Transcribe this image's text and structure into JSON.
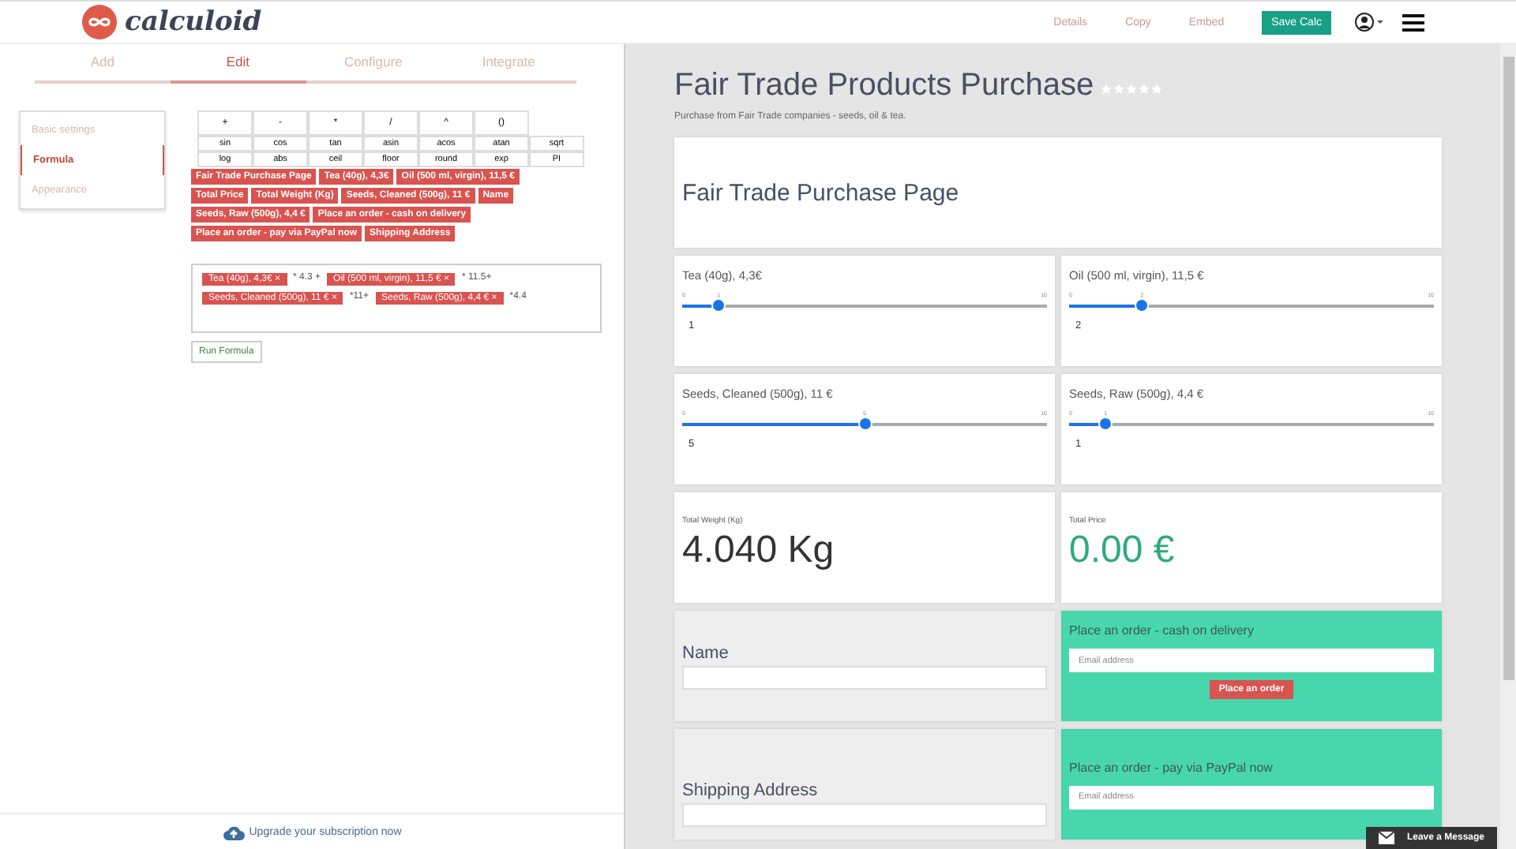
{
  "header": {
    "logo": "calculoid",
    "links": [
      {
        "label": "Details"
      },
      {
        "label": "Copy"
      },
      {
        "label": "Embed"
      }
    ],
    "save_button": "Save Calc"
  },
  "tabs": [
    {
      "label": "Add",
      "selected": false
    },
    {
      "label": "Edit",
      "selected": true
    },
    {
      "label": "Configure",
      "selected": false
    },
    {
      "label": "Integrate",
      "selected": false
    }
  ],
  "sidebar": {
    "items": [
      {
        "label": "Basic settings",
        "selected": false
      },
      {
        "label": "Formula",
        "selected": true
      },
      {
        "label": "Appearance",
        "selected": false
      }
    ]
  },
  "function_keys": [
    [
      "+",
      "-",
      "*",
      "/",
      "^",
      "()"
    ],
    [
      "sin",
      "cos",
      "tan",
      "asin",
      "acos",
      "atan",
      "sqrt"
    ],
    [
      "log",
      "abs",
      "ceil",
      "floor",
      "round",
      "exp",
      "PI"
    ]
  ],
  "field_tags": [
    "Fair Trade Purchase Page",
    "Tea (40g), 4,3€",
    "Oil (500 ml, virgin), 11,5 €",
    "Total Price",
    "Total Weight (Kg)",
    "Seeds, Cleaned (500g), 11 €",
    "Name",
    "Seeds, Raw (500g), 4,4 €",
    "Place an order - cash on delivery",
    "Place an order - pay via PayPal now",
    "Shipping Address"
  ],
  "formula": [
    {
      "kind": "tag",
      "text": "Tea (40g), 4,3€ ×"
    },
    {
      "kind": "text",
      "text": "* 4.3 +"
    },
    {
      "kind": "tag",
      "text": "Oil (500 ml, virgin), 11,5 € ×"
    },
    {
      "kind": "text",
      "text": "* 11.5+"
    },
    {
      "kind": "tag",
      "text": "Seeds, Cleaned (500g), 11 € ×"
    },
    {
      "kind": "text",
      "text": "*11+"
    },
    {
      "kind": "tag",
      "text": "Seeds, Raw (500g), 4,4 € ×"
    },
    {
      "kind": "text",
      "text": "*4.4"
    }
  ],
  "run_button": "Run Formula",
  "upgrade_link": "Upgrade your subscription now",
  "preview": {
    "title": "Fair Trade Products Purchase",
    "stars": 0,
    "subtitle": "Purchase from Fair Trade companies - seeds, oil & tea.",
    "rows": [
      [
        {
          "kind": "heading",
          "text": "Fair Trade Purchase Page"
        }
      ],
      [
        {
          "kind": "slider",
          "label": "Tea (40g), 4,3€",
          "min": "0",
          "max": "10",
          "tick": "1",
          "value": "1",
          "level": 0.1
        },
        {
          "kind": "slider",
          "label": "Oil (500 ml, virgin), 11,5 €",
          "min": "0",
          "max": "10",
          "tick": "2",
          "value": "2",
          "level": 0.2
        }
      ],
      [
        {
          "kind": "slider",
          "label": "Seeds, Cleaned (500g), 11 €",
          "min": "0",
          "max": "10",
          "tick": "5",
          "value": "5",
          "level": 0.5
        },
        {
          "kind": "slider",
          "label": "Seeds, Raw (500g), 4,4 €",
          "min": "0",
          "max": "10",
          "tick": "1",
          "value": "1",
          "level": 0.1
        }
      ],
      [
        {
          "kind": "result",
          "label": "Total Weight (Kg)",
          "value": "4.040 Kg",
          "accent": false
        },
        {
          "kind": "result",
          "label": "Total Price",
          "value": "0.00 €",
          "accent": true
        }
      ],
      [
        {
          "kind": "input",
          "label": "Name"
        },
        {
          "kind": "order",
          "label": "Place an order - cash on delivery",
          "placeholder": "Email address",
          "button": "Place an order"
        }
      ],
      [
        {
          "kind": "input",
          "label": "Shipping Address"
        },
        {
          "kind": "order",
          "label": "Place an order - pay via PayPal now",
          "placeholder": "Email address"
        }
      ]
    ]
  },
  "chat_button": "Leave a Message"
}
